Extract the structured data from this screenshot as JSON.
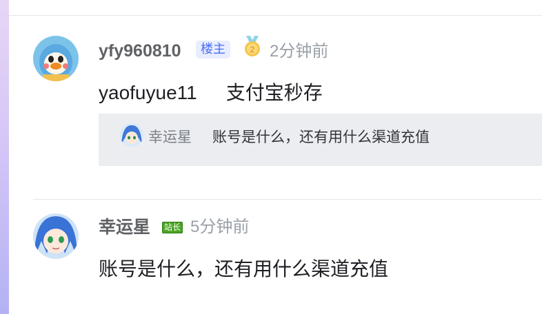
{
  "comments": [
    {
      "username": "yfy960810",
      "owner_badge": "楼主",
      "level_icon": "medal-level-2-icon",
      "level_number": "2",
      "timestamp": "2分钟前",
      "mention": "yaofuyue11",
      "body": "支付宝秒存",
      "quoted_reply": {
        "username": "幸运星",
        "text": "账号是什么，还有用什么渠道充值"
      }
    },
    {
      "username": "幸运星",
      "admin_badge": "站长",
      "timestamp": "5分钟前",
      "body": "账号是什么，还有用什么渠道充值"
    }
  ],
  "colors": {
    "owner_badge_text": "#4b6cf5",
    "owner_badge_bg": "#e8edff",
    "admin_badge_bg": "#4ca424",
    "reply_box_bg": "#ebedf0",
    "username": "#606266",
    "timestamp": "#9aa0a8"
  }
}
